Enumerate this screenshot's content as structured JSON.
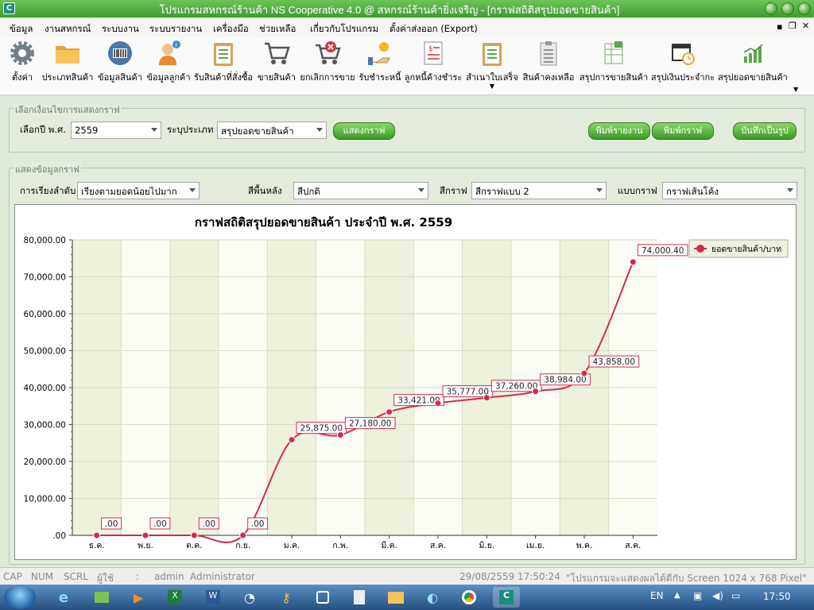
{
  "window": {
    "title": "โปรแกรมสหกรณ์ร้านค้า NS Cooperative 4.0 @ สหกรณ์ร้านค้ายิ่งเจริญ - [กราฟสถิติสรุปยอดขายสินค้า]",
    "icon_letter": "C"
  },
  "menu": [
    "ข้อมูล",
    "งานสหกรณ์",
    "ระบบงาน",
    "ระบบรายงาน",
    "เครื่องมือ",
    "ช่วยเหลือ",
    "เกี่ยวกับโปรแกรม",
    "ตั้งค่าส่งออก (Export)"
  ],
  "toolbar": [
    {
      "label": "ตั้งค่า",
      "icon": "gear-icon"
    },
    {
      "label": "ประเภทสินค้า",
      "icon": "folder-icon"
    },
    {
      "label": "ข้อมูลสินค้า",
      "icon": "barcode-icon"
    },
    {
      "label": "ข้อมูลลูกค้า",
      "icon": "customer-icon"
    },
    {
      "label": "รับสินค้าที่สั่งซื้อ",
      "icon": "clipboard-icon"
    },
    {
      "label": "ขายสินค้า",
      "icon": "cart-icon"
    },
    {
      "label": "ยกเลิกการขาย",
      "icon": "cart-cancel-icon"
    },
    {
      "label": "รับชำระหนี้",
      "icon": "payment-icon"
    },
    {
      "label": "ลูกหนี้ค้างชำระ",
      "icon": "invoice-icon"
    },
    {
      "label": "สำเนาใบเสร็จ",
      "icon": "receipt-icon"
    },
    {
      "label": "สินค้าคงเหลือ",
      "icon": "stock-icon"
    },
    {
      "label": "สรุปการขายสินค้า",
      "icon": "sales-summary-icon"
    },
    {
      "label": "สรุปเงินประจำกะ",
      "icon": "calendar-clock-icon"
    },
    {
      "label": "สรุปยอดขายสินค้า",
      "icon": "bar-chart-icon"
    }
  ],
  "options_panel": {
    "title": "เลือกเงื่อนไขการแสดงกราฟ",
    "year_label": "เลือกปี พ.ศ.",
    "year_value": "2559",
    "type_label": "ระบุประเภท",
    "type_value": "สรุปยอดขายสินค้า",
    "show_button": "แสดงกราฟ",
    "print_report_button": "พิมพ์รายงาน",
    "print_chart_button": "พิมพ์กราฟ",
    "save_image_button": "บันทึกเป็นรูป"
  },
  "display_panel": {
    "title": "แสดงข้อมูลกราฟ",
    "sort_label": "การเรียงลำดับ",
    "sort_value": "เรียงตามยอดน้อยไปมาก",
    "bg_label": "สีพื้นหลัง",
    "bg_value": "สีปกติ",
    "color_label": "สีกราฟ",
    "color_value": "สีกราฟแบบ 2",
    "type_label": "แบบกราฟ",
    "type_value": "กราฟเส้นโค้ง"
  },
  "chart_data": {
    "type": "line",
    "title": "กราฟสถิติสรุปยอดขายสินค้า ประจำปี พ.ศ. 2559",
    "categories": [
      "ธ.ค.",
      "พ.ย.",
      "ต.ค.",
      "ก.ย.",
      "ม.ค.",
      "ก.พ.",
      "มี.ค.",
      "ส.ค.",
      "มิ.ย.",
      "เม.ย.",
      "พ.ค.",
      "ส.ค."
    ],
    "series": [
      {
        "name": "ยอดขายสินค้า/บาท",
        "values": [
          0,
          0,
          0,
          0,
          25875,
          27180,
          33421,
          35777,
          37260,
          38984,
          43858,
          74000.4
        ],
        "color": "#d42b4b"
      }
    ],
    "data_labels": [
      ".00",
      ".00",
      ".00",
      ".00",
      "25,875.00",
      "27,180.00",
      "33,421.00",
      "35,777.00",
      "37,260.00",
      "38,984.00",
      "43,858.00",
      "74,000.40"
    ],
    "y_ticks": [
      ".00",
      "10,000.00",
      "20,000.00",
      "30,000.00",
      "40,000.00",
      "50,000.00",
      "60,000.00",
      "70,000.00",
      "80,000.00"
    ],
    "ylim": [
      0,
      80000
    ],
    "legend_position": "top-right",
    "grid": true,
    "curve": "smooth"
  },
  "statusbar": {
    "cap": "CAP",
    "num": "NUM",
    "scrl": "SCRL",
    "user_label": "ผู้ใช้",
    "user_sep": ":",
    "user_id": "admin",
    "user_name": "Administrator",
    "date": "29/08/2559",
    "time": "17:50:24",
    "message": "\"โปรแกรมจะแสดงผลได้ดีกับ  Screen 1024 x 768 Pixel\""
  },
  "taskbar": {
    "lang": "EN",
    "clock": "17:50"
  }
}
